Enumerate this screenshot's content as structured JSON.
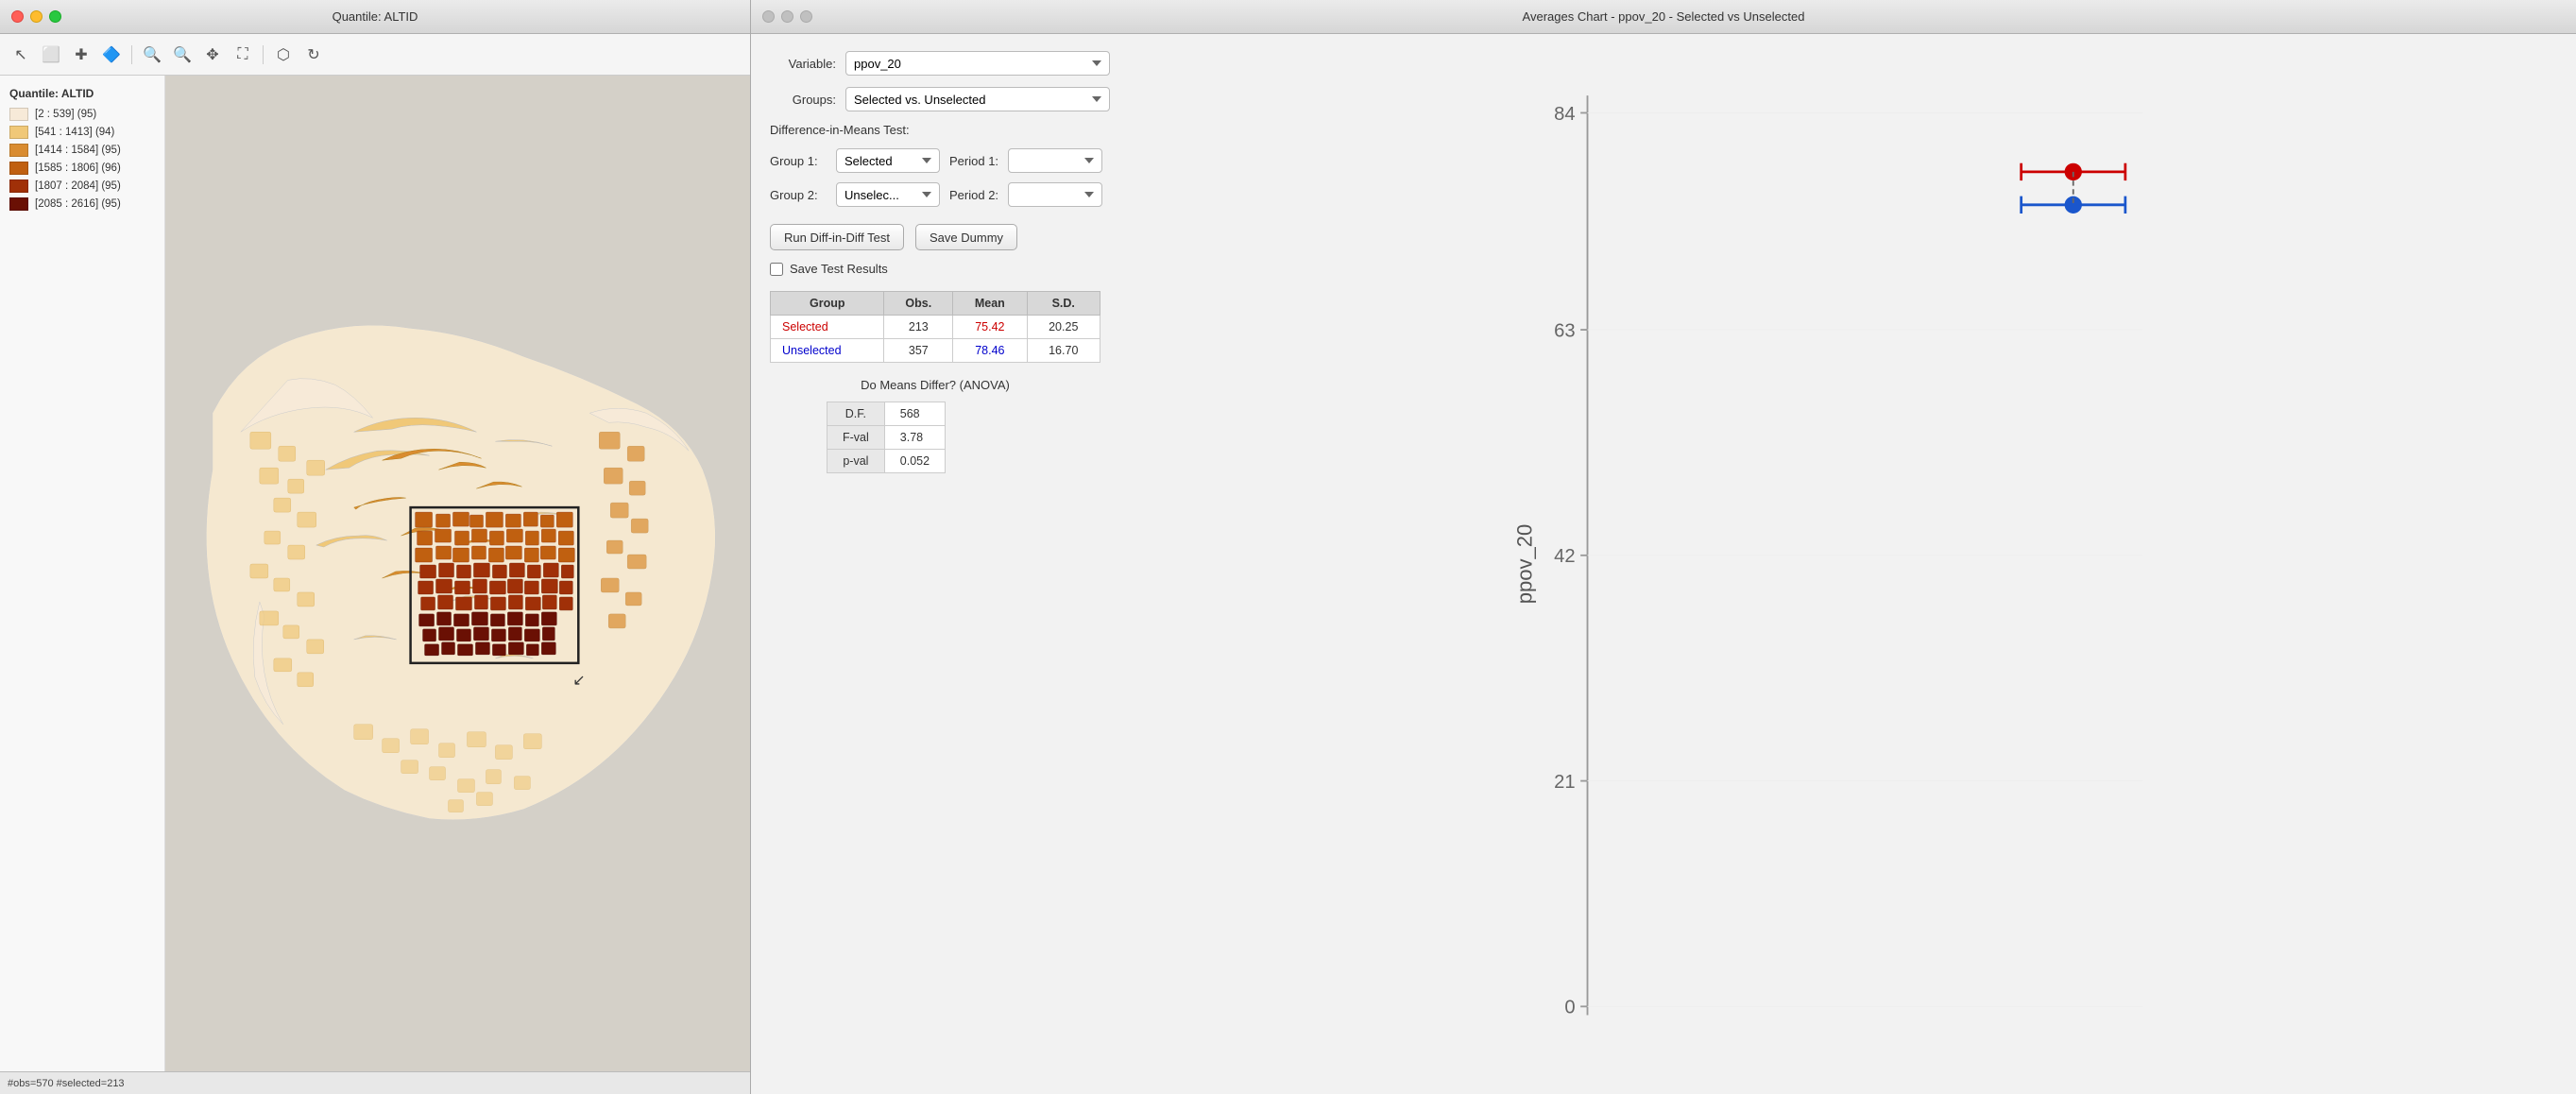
{
  "map_window": {
    "title": "Quantile: ALTID",
    "legend": {
      "title": "Quantile: ALTID",
      "items": [
        {
          "label": "[2 : 539] (95)",
          "color": "#f7ead8"
        },
        {
          "label": "[541 : 1413] (94)",
          "color": "#f0c878"
        },
        {
          "label": "[1414 : 1584] (95)",
          "color": "#d98c30"
        },
        {
          "label": "[1585 : 1806] (96)",
          "color": "#c06010"
        },
        {
          "label": "[1807 : 2084] (95)",
          "color": "#a03008"
        },
        {
          "label": "[2085 : 2616] (95)",
          "color": "#6a1004"
        }
      ]
    },
    "toolbar": {
      "tools": [
        "pointer",
        "select",
        "add",
        "layer",
        "zoom-in",
        "zoom-out",
        "pan",
        "fullscreen",
        "select-region",
        "refresh"
      ]
    },
    "status": "#obs=570 #selected=213"
  },
  "chart_window": {
    "title": "Averages Chart - ppov_20 - Selected vs Unselected",
    "controls": {
      "variable_label": "Variable:",
      "variable_value": "ppov_20",
      "groups_label": "Groups:",
      "groups_value": "Selected vs. Unselected",
      "diff_means_label": "Difference-in-Means Test:",
      "group1_label": "Group 1:",
      "group1_value": "Selected",
      "period1_label": "Period 1:",
      "period1_value": "",
      "group2_label": "Group 2:",
      "group2_value": "Unselec...",
      "period2_label": "Period 2:",
      "period2_value": "",
      "run_button": "Run Diff-in-Diff Test",
      "save_dummy_button": "Save Dummy",
      "save_results_label": "Save Test Results"
    },
    "table": {
      "headers": [
        "Group",
        "Obs.",
        "Mean",
        "S.D."
      ],
      "rows": [
        {
          "group": "Selected",
          "obs": "213",
          "mean": "75.42",
          "sd": "20.25",
          "type": "selected"
        },
        {
          "group": "Unselected",
          "obs": "357",
          "mean": "78.46",
          "sd": "16.70",
          "type": "unselected"
        }
      ]
    },
    "anova": {
      "title": "Do Means Differ? (ANOVA)",
      "rows": [
        {
          "label": "D.F.",
          "value": "568"
        },
        {
          "label": "F-val",
          "value": "3.78"
        },
        {
          "label": "p-val",
          "value": "0.052"
        }
      ]
    },
    "chart": {
      "y_label": "ppov_20",
      "y_ticks": [
        "84",
        "63",
        "42",
        "21",
        "0"
      ],
      "dot_selected_color": "#1a56cc",
      "dot_unselected_color": "#cc0000",
      "selected_mean": 75.42,
      "unselected_mean": 78.46,
      "y_min": 0,
      "y_max": 84
    }
  }
}
